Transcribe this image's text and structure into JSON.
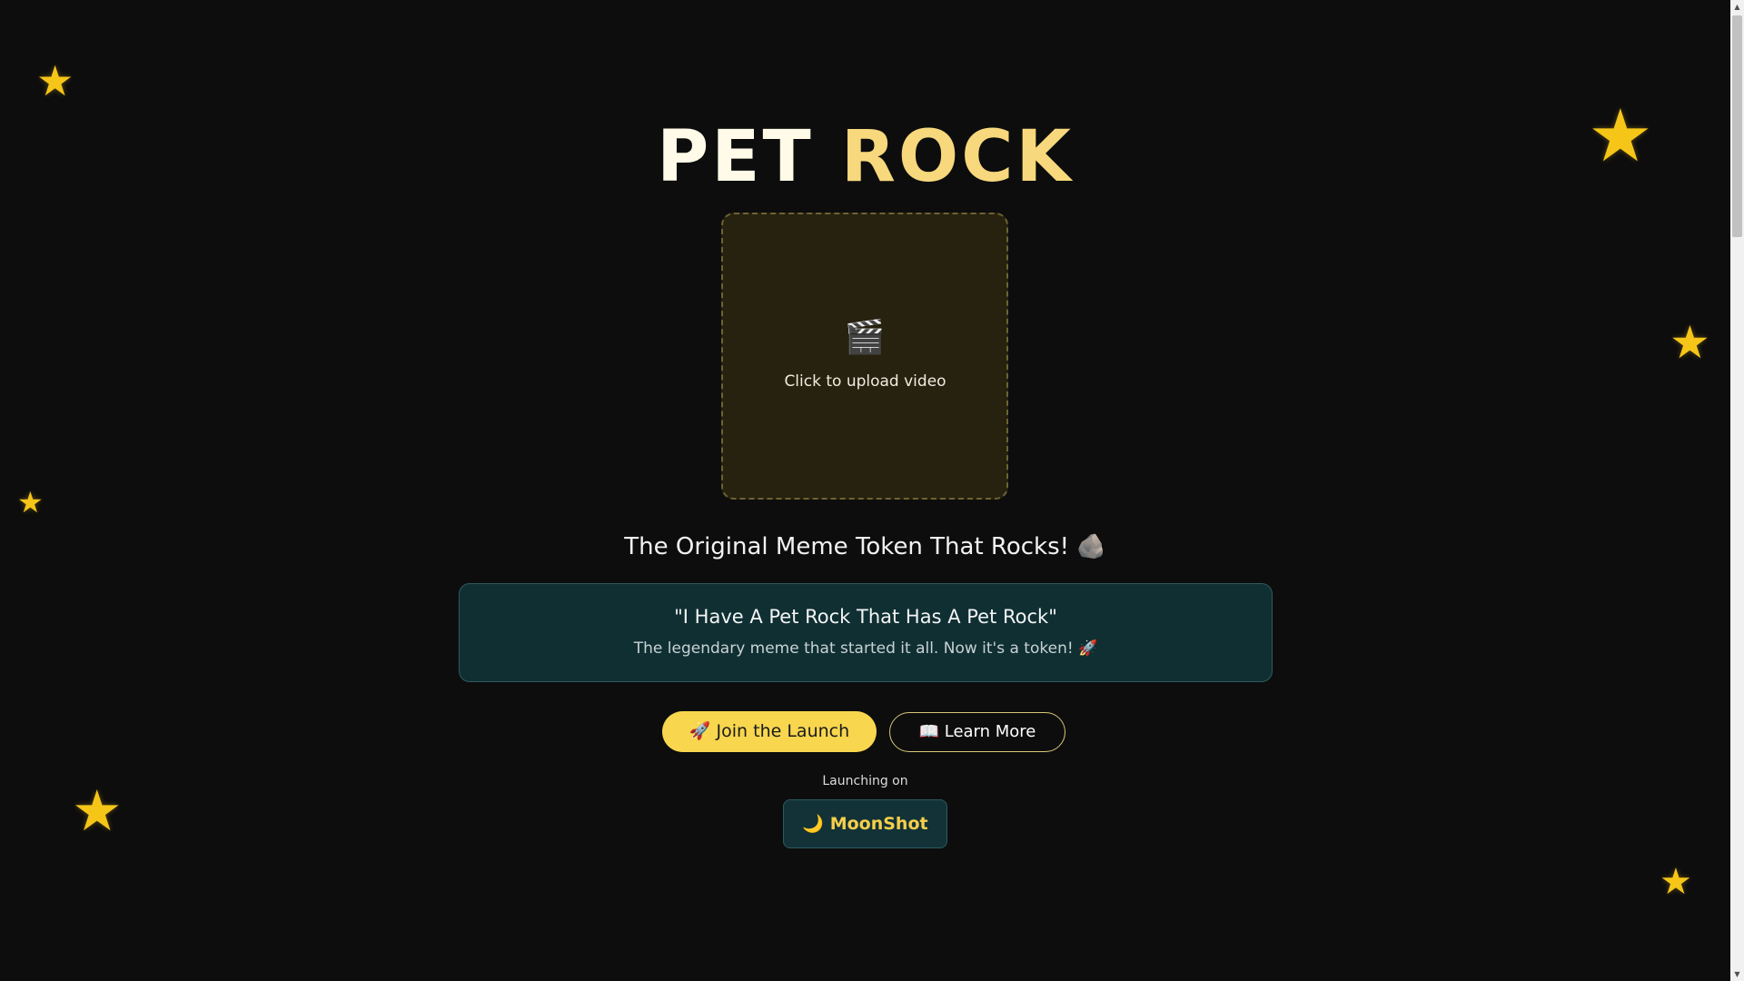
{
  "brand": {
    "title_part1": "PET ",
    "title_part2": "ROCK",
    "title_color1": "#fffbe8",
    "title_color2": "#f7d87c"
  },
  "upload": {
    "icon": "🎬",
    "icon_name": "clapper-board-icon",
    "label": "Click to upload video"
  },
  "tagline": "The Original Meme Token That Rocks! 🪨",
  "quote": {
    "title": "\"I Have A Pet Rock That Has A Pet Rock\"",
    "subtitle": "The legendary meme that started it all. Now it's a token! 🚀"
  },
  "actions": {
    "primary_label": "🚀 Join the Launch",
    "secondary_label": "📖 Learn More"
  },
  "launch": {
    "label": "Launching on",
    "platform_icon": "🌙",
    "platform_name": "MoonShot"
  },
  "decor": {
    "star_glyph": "★",
    "star_color": "#f5c518"
  },
  "colors": {
    "background": "#0d0d0d",
    "accent": "#f8d64e",
    "card": "#0f2f33"
  }
}
